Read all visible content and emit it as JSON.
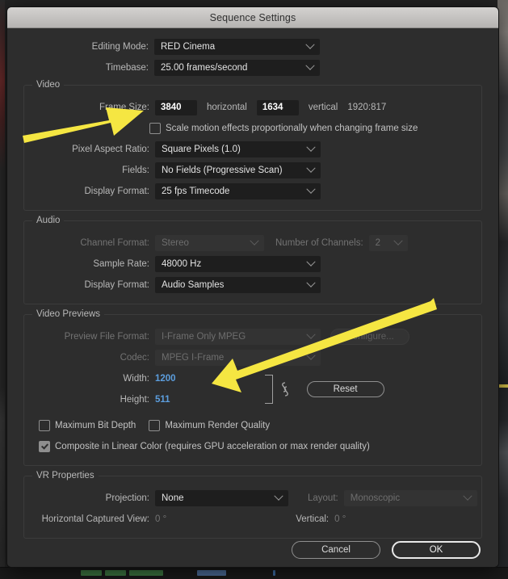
{
  "window": {
    "title": "Sequence Settings"
  },
  "top": {
    "editing_mode": {
      "label": "Editing Mode:",
      "value": "RED Cinema"
    },
    "timebase": {
      "label": "Timebase:",
      "value": "25.00  frames/second"
    }
  },
  "video": {
    "group_title": "Video",
    "frame_size": {
      "label": "Frame Size:",
      "horizontal_value": "3840",
      "horizontal_label": "horizontal",
      "vertical_value": "1634",
      "vertical_label": "vertical",
      "ratio": "1920:817"
    },
    "scale_motion": {
      "label": "Scale motion effects proportionally when changing frame size",
      "checked": false
    },
    "pixel_aspect_ratio": {
      "label": "Pixel Aspect Ratio:",
      "value": "Square Pixels (1.0)"
    },
    "fields": {
      "label": "Fields:",
      "value": "No Fields (Progressive Scan)"
    },
    "display_format": {
      "label": "Display Format:",
      "value": "25 fps Timecode"
    }
  },
  "audio": {
    "group_title": "Audio",
    "channel_format": {
      "label": "Channel Format:",
      "value": "Stereo",
      "disabled": true
    },
    "number_of_channels": {
      "label": "Number of Channels:",
      "value": "2",
      "disabled": true
    },
    "sample_rate": {
      "label": "Sample Rate:",
      "value": "48000 Hz"
    },
    "display_format": {
      "label": "Display Format:",
      "value": "Audio Samples"
    }
  },
  "video_previews": {
    "group_title": "Video Previews",
    "preview_file_format": {
      "label": "Preview File Format:",
      "value": "I-Frame Only MPEG",
      "disabled": true
    },
    "configure_button": {
      "label": "Configure...",
      "disabled": true
    },
    "codec": {
      "label": "Codec:",
      "value": "MPEG I-Frame",
      "disabled": true
    },
    "width": {
      "label": "Width:",
      "value": "1200"
    },
    "height": {
      "label": "Height:",
      "value": "511"
    },
    "reset_button": {
      "label": "Reset"
    },
    "max_bit_depth": {
      "label": "Maximum Bit Depth",
      "checked": false
    },
    "max_render_quality": {
      "label": "Maximum Render Quality",
      "checked": false
    },
    "composite_linear": {
      "label": "Composite in Linear Color (requires GPU acceleration or max render quality)",
      "checked": true
    }
  },
  "vr_properties": {
    "group_title": "VR Properties",
    "projection": {
      "label": "Projection:",
      "value": "None"
    },
    "layout": {
      "label": "Layout:",
      "value": "Monoscopic",
      "disabled": true
    },
    "horizontal_captured_view": {
      "label": "Horizontal Captured View:",
      "value": "0 °"
    },
    "vertical": {
      "label": "Vertical:",
      "value": "0 °"
    }
  },
  "footer": {
    "cancel_label": "Cancel",
    "ok_label": "OK"
  },
  "annotations": {
    "arrow_color": "#F5E642",
    "arrow_1_target": "Frame Size",
    "arrow_2_target": "Width / Height"
  }
}
